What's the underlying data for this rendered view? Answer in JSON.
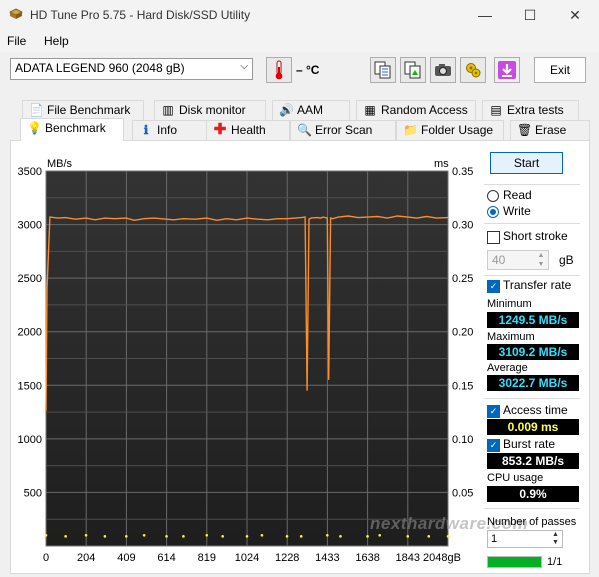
{
  "window": {
    "title": "HD Tune Pro 5.75 - Hard Disk/SSD Utility",
    "minimize": "—",
    "maximize": "☐",
    "close": "✕"
  },
  "menu": [
    "File",
    "Help"
  ],
  "toolbar": {
    "drive": "ADATA LEGEND 960 (2048 gB)",
    "temperature": "– °C",
    "exit_label": "Exit"
  },
  "tabs_top": [
    "File Benchmark",
    "Disk monitor",
    "AAM",
    "Random Access",
    "Extra tests"
  ],
  "tabs_bottom": [
    "Benchmark",
    "Info",
    "Health",
    "Error Scan",
    "Folder Usage",
    "Erase"
  ],
  "side": {
    "start_label": "Start",
    "read_label": "Read",
    "write_label": "Write",
    "mode": "Write",
    "short_stroke_label": "Short stroke",
    "short_stroke_checked": false,
    "stroke_value": "40",
    "stroke_unit": "gB",
    "transfer_rate_label": "Transfer rate",
    "transfer_rate_checked": true,
    "minimum_label": "Minimum",
    "minimum": "1249.5 MB/s",
    "maximum_label": "Maximum",
    "maximum": "3109.2 MB/s",
    "average_label": "Average",
    "average": "3022.7 MB/s",
    "access_time_label": "Access time",
    "access_time_checked": true,
    "access_time": "0.009 ms",
    "burst_rate_label": "Burst rate",
    "burst_rate_checked": true,
    "burst_rate": "853.2 MB/s",
    "cpu_usage_label": "CPU usage",
    "cpu_usage": "0.9%",
    "passes_label": "Number of passes",
    "passes_value": "1",
    "progress_text": "1/1",
    "progress": 1.0
  },
  "watermark": "nexthardware.com",
  "chart_data": {
    "type": "line",
    "ylabel": "MB/s",
    "y2label": "ms",
    "xlim": [
      0,
      2048
    ],
    "ylim": [
      0,
      3500
    ],
    "y2lim": [
      0,
      0.35
    ],
    "x_ticks": [
      "0",
      "204",
      "409",
      "614",
      "819",
      "1024",
      "1228",
      "1433",
      "1638",
      "1843",
      "2048gB"
    ],
    "y_ticks": [
      "3500",
      "3000",
      "2500",
      "2000",
      "1500",
      "1000",
      "500"
    ],
    "y2_ticks": [
      "0.35",
      "0.30",
      "0.25",
      "0.20",
      "0.15",
      "0.10",
      "0.05"
    ],
    "grid": true,
    "series": [
      {
        "color": "#ff8c28",
        "x": [
          0,
          5,
          20,
          60,
          100,
          150,
          204,
          250,
          300,
          350,
          409,
          450,
          500,
          550,
          614,
          650,
          700,
          760,
          819,
          870,
          920,
          970,
          1024,
          1080,
          1130,
          1180,
          1228,
          1270,
          1300,
          1320,
          1330,
          1340,
          1350,
          1380,
          1400,
          1410,
          1433,
          1440,
          1450,
          1460,
          1490,
          1540,
          1590,
          1638,
          1690,
          1740,
          1790,
          1843,
          1890,
          1940,
          1990,
          2048
        ],
        "y": [
          1260,
          2400,
          3070,
          3060,
          3065,
          3050,
          3060,
          3045,
          3060,
          3055,
          3060,
          3040,
          3055,
          3060,
          3050,
          3045,
          3055,
          3050,
          3060,
          3040,
          3055,
          3045,
          3060,
          3050,
          3045,
          3055,
          3055,
          3060,
          3065,
          3070,
          1450,
          3050,
          3060,
          3065,
          3060,
          3070,
          3060,
          1550,
          3060,
          3055,
          3070,
          3080,
          3065,
          3070,
          3075,
          3060,
          3080,
          3070,
          3060,
          3075,
          3060,
          3065
        ]
      },
      {
        "color": "#ffff00",
        "y_axis": "ms",
        "x": [
          0,
          100,
          204,
          300,
          409,
          500,
          614,
          700,
          819,
          900,
          1024,
          1100,
          1228,
          1300,
          1433,
          1500,
          1638,
          1700,
          1843,
          1950,
          2048
        ],
        "y": [
          0.01,
          0.009,
          0.01,
          0.009,
          0.009,
          0.01,
          0.009,
          0.009,
          0.01,
          0.009,
          0.009,
          0.01,
          0.009,
          0.009,
          0.01,
          0.009,
          0.009,
          0.01,
          0.009,
          0.009,
          0.009
        ]
      }
    ]
  }
}
